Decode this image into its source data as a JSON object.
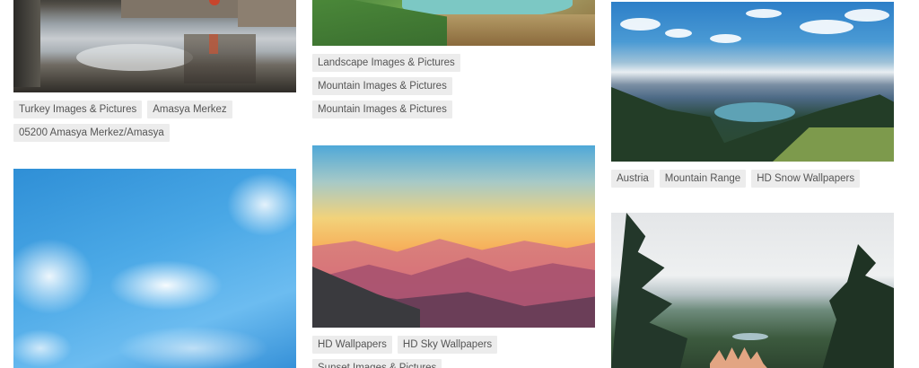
{
  "column_1": {
    "card_1": {
      "tags": [
        "Turkey Images & Pictures",
        "Amasya Merkez",
        "05200 Amasya Merkez/Amasya"
      ]
    },
    "card_2": {
      "tags": []
    }
  },
  "column_2": {
    "card_1": {
      "tags": [
        "Landscape Images & Pictures",
        "Mountain Images & Pictures",
        "Mountain Images & Pictures"
      ]
    },
    "card_2": {
      "tags": [
        "HD Wallpapers",
        "HD Sky Wallpapers",
        "Sunset Images & Pictures"
      ]
    }
  },
  "column_3": {
    "card_1": {
      "tags": [
        "Austria",
        "Mountain Range",
        "HD Snow Wallpapers"
      ]
    },
    "card_2": {
      "tags": []
    }
  },
  "colors": {
    "tag_background": "#ececec",
    "tag_text": "#555555",
    "page_background": "#ffffff"
  }
}
